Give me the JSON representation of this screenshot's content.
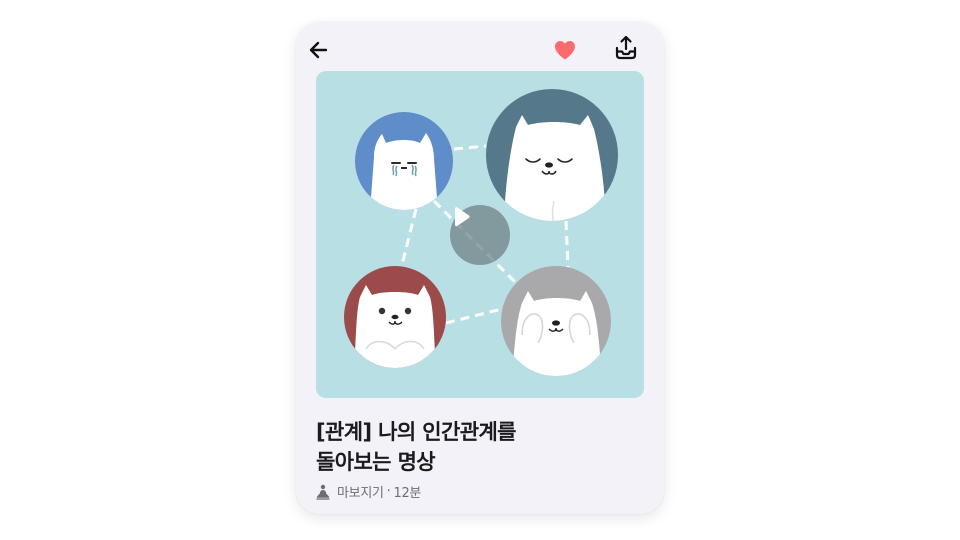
{
  "header": {
    "back_icon": "arrow-left-icon",
    "favorite_icon": "heart-icon",
    "favorite_color": "#fb6b6b",
    "share_icon": "share-upload-icon"
  },
  "media": {
    "background_color": "#b7dfe4",
    "play_icon": "play-icon",
    "illustration": "four white cats in circles connected by dashed lines"
  },
  "content": {
    "title_line1": "[관계] 나의 인간관계를",
    "title_line2": "돌아보는 명상",
    "meta_icon": "meditation-person-icon",
    "author": "마보지기",
    "separator": "·",
    "duration": "12분"
  },
  "colors": {
    "card_background": "#f4f2f9",
    "title_color": "#1b1b1f",
    "meta_color": "#6d6d78",
    "circle_blue": "#5f8dc9",
    "circle_teal": "#55798a",
    "circle_red": "#9c4b4b",
    "circle_gray": "#a9a9ab"
  }
}
